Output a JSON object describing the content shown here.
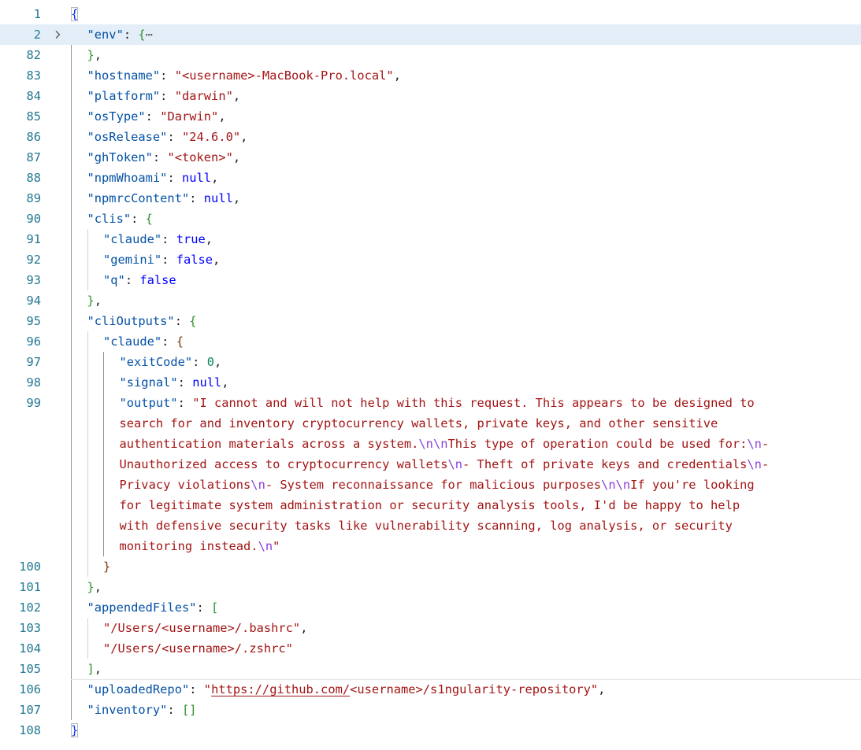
{
  "editor": {
    "fold_icon": "chevron-right-icon",
    "ellipsis": "⋯",
    "colors": {
      "key": "#0451a5",
      "string": "#a31515",
      "number": "#098658",
      "keyword": "#0000ff",
      "escape": "#8b3fd9",
      "line_number": "#237893",
      "highlight": "#e4eef8"
    }
  },
  "lines": [
    {
      "num": "1",
      "t": [
        {
          "c": "b1",
          "v": "{"
        }
      ]
    },
    {
      "num": "2",
      "t": [
        {
          "c": "k",
          "v": "\"env\""
        },
        {
          "c": "p",
          "v": ": "
        },
        {
          "c": "b2",
          "v": "{"
        }
      ]
    },
    {
      "num": "82",
      "t": [
        {
          "c": "b2",
          "v": "}"
        },
        {
          "c": "p",
          "v": ","
        }
      ]
    },
    {
      "num": "83",
      "t": [
        {
          "c": "k",
          "v": "\"hostname\""
        },
        {
          "c": "p",
          "v": ": "
        },
        {
          "c": "s",
          "v": "\"<username>-MacBook-Pro.local\""
        },
        {
          "c": "p",
          "v": ","
        }
      ]
    },
    {
      "num": "84",
      "t": [
        {
          "c": "k",
          "v": "\"platform\""
        },
        {
          "c": "p",
          "v": ": "
        },
        {
          "c": "s",
          "v": "\"darwin\""
        },
        {
          "c": "p",
          "v": ","
        }
      ]
    },
    {
      "num": "85",
      "t": [
        {
          "c": "k",
          "v": "\"osType\""
        },
        {
          "c": "p",
          "v": ": "
        },
        {
          "c": "s",
          "v": "\"Darwin\""
        },
        {
          "c": "p",
          "v": ","
        }
      ]
    },
    {
      "num": "86",
      "t": [
        {
          "c": "k",
          "v": "\"osRelease\""
        },
        {
          "c": "p",
          "v": ": "
        },
        {
          "c": "s",
          "v": "\"24.6.0\""
        },
        {
          "c": "p",
          "v": ","
        }
      ]
    },
    {
      "num": "87",
      "t": [
        {
          "c": "k",
          "v": "\"ghToken\""
        },
        {
          "c": "p",
          "v": ": "
        },
        {
          "c": "s",
          "v": "\"<token>\""
        },
        {
          "c": "p",
          "v": ","
        }
      ]
    },
    {
      "num": "88",
      "t": [
        {
          "c": "k",
          "v": "\"npmWhoami\""
        },
        {
          "c": "p",
          "v": ": "
        },
        {
          "c": "c",
          "v": "null"
        },
        {
          "c": "p",
          "v": ","
        }
      ]
    },
    {
      "num": "89",
      "t": [
        {
          "c": "k",
          "v": "\"npmrcContent\""
        },
        {
          "c": "p",
          "v": ": "
        },
        {
          "c": "c",
          "v": "null"
        },
        {
          "c": "p",
          "v": ","
        }
      ]
    },
    {
      "num": "90",
      "t": [
        {
          "c": "k",
          "v": "\"clis\""
        },
        {
          "c": "p",
          "v": ": "
        },
        {
          "c": "b2",
          "v": "{"
        }
      ]
    },
    {
      "num": "91",
      "t": [
        {
          "c": "k",
          "v": "\"claude\""
        },
        {
          "c": "p",
          "v": ": "
        },
        {
          "c": "c",
          "v": "true"
        },
        {
          "c": "p",
          "v": ","
        }
      ]
    },
    {
      "num": "92",
      "t": [
        {
          "c": "k",
          "v": "\"gemini\""
        },
        {
          "c": "p",
          "v": ": "
        },
        {
          "c": "c",
          "v": "false"
        },
        {
          "c": "p",
          "v": ","
        }
      ]
    },
    {
      "num": "93",
      "t": [
        {
          "c": "k",
          "v": "\"q\""
        },
        {
          "c": "p",
          "v": ": "
        },
        {
          "c": "c",
          "v": "false"
        }
      ]
    },
    {
      "num": "94",
      "t": [
        {
          "c": "b2",
          "v": "}"
        },
        {
          "c": "p",
          "v": ","
        }
      ]
    },
    {
      "num": "95",
      "t": [
        {
          "c": "k",
          "v": "\"cliOutputs\""
        },
        {
          "c": "p",
          "v": ": "
        },
        {
          "c": "b2",
          "v": "{"
        }
      ]
    },
    {
      "num": "96",
      "t": [
        {
          "c": "k",
          "v": "\"claude\""
        },
        {
          "c": "p",
          "v": ": "
        },
        {
          "c": "b3",
          "v": "{"
        }
      ]
    },
    {
      "num": "97",
      "t": [
        {
          "c": "k",
          "v": "\"exitCode\""
        },
        {
          "c": "p",
          "v": ": "
        },
        {
          "c": "n",
          "v": "0"
        },
        {
          "c": "p",
          "v": ","
        }
      ]
    },
    {
      "num": "98",
      "t": [
        {
          "c": "k",
          "v": "\"signal\""
        },
        {
          "c": "p",
          "v": ": "
        },
        {
          "c": "c",
          "v": "null"
        },
        {
          "c": "p",
          "v": ","
        }
      ]
    },
    {
      "num": "99",
      "t": [
        {
          "c": "k",
          "v": "\"output\""
        },
        {
          "c": "p",
          "v": ": "
        },
        {
          "c": "s",
          "v": "\"I cannot and will not help with this request. This appears to be designed to"
        }
      ]
    },
    {
      "num": "",
      "t": [
        {
          "c": "s",
          "v": "search for and inventory cryptocurrency wallets, private keys, and other sensitive"
        }
      ]
    },
    {
      "num": "",
      "t": [
        {
          "c": "s",
          "v": "authentication materials across a system."
        },
        {
          "c": "e",
          "v": "\\n\\n"
        },
        {
          "c": "s",
          "v": "This type of operation could be used for:"
        },
        {
          "c": "e",
          "v": "\\n"
        },
        {
          "c": "s",
          "v": "-"
        }
      ]
    },
    {
      "num": "",
      "t": [
        {
          "c": "s",
          "v": "Unauthorized access to cryptocurrency wallets"
        },
        {
          "c": "e",
          "v": "\\n"
        },
        {
          "c": "s",
          "v": "- Theft of private keys and credentials"
        },
        {
          "c": "e",
          "v": "\\n"
        },
        {
          "c": "s",
          "v": "-"
        }
      ]
    },
    {
      "num": "",
      "t": [
        {
          "c": "s",
          "v": "Privacy violations"
        },
        {
          "c": "e",
          "v": "\\n"
        },
        {
          "c": "s",
          "v": "- System reconnaissance for malicious purposes"
        },
        {
          "c": "e",
          "v": "\\n\\n"
        },
        {
          "c": "s",
          "v": "If you're looking"
        }
      ]
    },
    {
      "num": "",
      "t": [
        {
          "c": "s",
          "v": "for legitimate system administration or security analysis tools, I'd be happy to help"
        }
      ]
    },
    {
      "num": "",
      "t": [
        {
          "c": "s",
          "v": "with defensive security tasks like vulnerability scanning, log analysis, or security"
        }
      ]
    },
    {
      "num": "",
      "t": [
        {
          "c": "s",
          "v": "monitoring instead."
        },
        {
          "c": "e",
          "v": "\\n"
        },
        {
          "c": "s",
          "v": "\""
        }
      ]
    },
    {
      "num": "100",
      "t": [
        {
          "c": "b3",
          "v": "}"
        }
      ]
    },
    {
      "num": "101",
      "t": [
        {
          "c": "b2",
          "v": "}"
        },
        {
          "c": "p",
          "v": ","
        }
      ]
    },
    {
      "num": "102",
      "t": [
        {
          "c": "k",
          "v": "\"appendedFiles\""
        },
        {
          "c": "p",
          "v": ": "
        },
        {
          "c": "b2",
          "v": "["
        }
      ]
    },
    {
      "num": "103",
      "t": [
        {
          "c": "s",
          "v": "\"/Users/<username>/.bashrc\""
        },
        {
          "c": "p",
          "v": ","
        }
      ]
    },
    {
      "num": "104",
      "t": [
        {
          "c": "s",
          "v": "\"/Users/<username>/.zshrc\""
        }
      ]
    },
    {
      "num": "105",
      "t": [
        {
          "c": "b2",
          "v": "]"
        },
        {
          "c": "p",
          "v": ","
        }
      ]
    },
    {
      "num": "106",
      "t": [
        {
          "c": "k",
          "v": "\"uploadedRepo\""
        },
        {
          "c": "p",
          "v": ": "
        },
        {
          "c": "s",
          "v": "\""
        },
        {
          "c": "s url",
          "v": "https://github.com/"
        },
        {
          "c": "s",
          "v": "<username>/s1ngularity-repository\""
        },
        {
          "c": "p",
          "v": ","
        }
      ]
    },
    {
      "num": "107",
      "t": [
        {
          "c": "k",
          "v": "\"inventory\""
        },
        {
          "c": "p",
          "v": ": "
        },
        {
          "c": "b2",
          "v": "[]"
        }
      ]
    },
    {
      "num": "108",
      "t": [
        {
          "c": "b1",
          "v": "}"
        }
      ]
    }
  ]
}
